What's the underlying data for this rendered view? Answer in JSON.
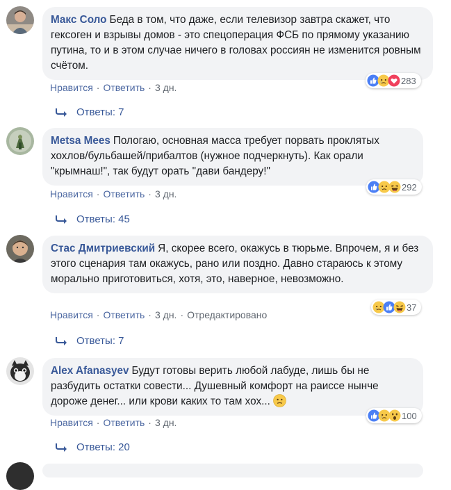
{
  "actions": {
    "like": "Нравится",
    "reply": "Ответить",
    "edited": "Отредактировано"
  },
  "comments": [
    {
      "author": "Макс Соло",
      "text": "Беда в том, что даже, если телевизор завтра скажет, что гексоген и взрывы домов - это спецоперация ФСБ по прямому указанию путина, то и в этом случае ничего в головах россиян не изменится ровным счётом.",
      "time": "3 дн.",
      "reactions": [
        "like",
        "sad",
        "love"
      ],
      "reaction_count": "283",
      "replies": "Ответы: 7"
    },
    {
      "author": "Metsa Mees",
      "text": "Пологаю, основная масса требует порвать проклятых хохлов/бульбашей/прибалтов (нужное подчеркнуть). Как орали \"крымнаш!\", так будут орать \"дави бандеру!\"",
      "time": "3 дн.",
      "reactions": [
        "like",
        "sad",
        "haha"
      ],
      "reaction_count": "292",
      "replies": "Ответы: 45"
    },
    {
      "author": "Стас Дмитриевский",
      "text": "Я, скорее всего, окажусь в тюрьме. Впрочем, я и без этого сценария там окажусь, рано или поздно. Давно стараюсь к этому морально приготовиться, хотя, это, наверное, невозможно.",
      "time": "3 дн.",
      "edited": true,
      "reactions": [
        "sad",
        "like",
        "haha"
      ],
      "reaction_count": "37",
      "replies": "Ответы: 7"
    },
    {
      "author": "Alex Afanasyev",
      "text": "Будут готовы верить любой лабуде, лишь бы не разбудить остатки совести... Душевный комфорт на раиссе нынче дороже денег... или крови каких то там хох...",
      "inline_emoji": "confused-face",
      "time": "3 дн.",
      "reactions": [
        "like",
        "sad",
        "wow"
      ],
      "reaction_count": "100",
      "replies": "Ответы: 20"
    }
  ]
}
